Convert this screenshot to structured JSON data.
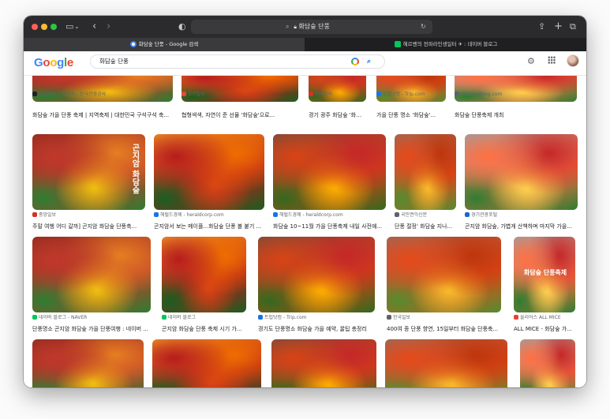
{
  "browser": {
    "url": "화담숲 단풍",
    "tabs": [
      {
        "title": "화담숲 단풍 - Google 검색",
        "active": true
      },
      {
        "title": "헤르벤의 전파라인생일터 ✈ : 네이버 블로그",
        "active": false
      }
    ]
  },
  "google": {
    "logo": "Google",
    "query": "화담숲 단풍",
    "logo_colors": [
      "#4285f4",
      "#ea4335",
      "#fbbc05",
      "#4285f4",
      "#34a853",
      "#ea4335"
    ]
  },
  "results": [
    {
      "source": "대한민국 구석구석 - 한국관광공사",
      "caption": "화담숲 가을 단풍 축제 | 지역축제 | 대한민국 구석구석 축...",
      "color": "#202124"
    },
    {
      "source": "조선일보",
      "caption": "협형색색, 자연이 준 선물 '화담숲'으로...",
      "color": "#e24a3b"
    },
    {
      "source": "이데일리",
      "caption": "경기 광주 화담숲 '화담...",
      "color": "#d93025"
    },
    {
      "source": "트립닷컴 - Trip.com",
      "caption": "가을 단풍 명소 '화담숲'...",
      "color": "#1a73e8"
    },
    {
      "source": "dnocorpblog.com",
      "caption": "화담숲 단풍축제 개최",
      "color": "#5f6368"
    },
    {
      "source": "중앙일보",
      "caption": "주말 여행 어디 갈까] 곤지암 화담숲 단풍축...",
      "color": "#d93025",
      "overlay": "곤지암 화담숲"
    },
    {
      "source": "헤럴드경제 - heraldcorp.com",
      "caption": "곤지암서 보는 메이플...화담숲 단풍 볼 붙기 ...",
      "color": "#1a73e8"
    },
    {
      "source": "헤럴드경제 - heraldcorp.com",
      "caption": "화담숲 10~11월 가을 단풍축제 내일 사전예...",
      "color": "#1a73e8"
    },
    {
      "source": "국민권익신문",
      "caption": "단풍 절정' 화담숲 지나...",
      "color": "#5f6368"
    },
    {
      "source": "경기관광포털",
      "caption": "곤지암 화담숲, 가볍게 산책하며 마지막 가을...",
      "color": "#1967d2"
    },
    {
      "source": "네이버 블로그 - NAVER",
      "caption": "단풍명소 곤지암 화담숲 가을 단풍여행 : 네이버 ...",
      "color": "#03c75a"
    },
    {
      "source": "네이버 블로그",
      "caption": "곤지암 화담숲 단풍 축제 시기 가...",
      "color": "#03c75a"
    },
    {
      "source": "트립닷컴 - Trip.com",
      "caption": "경기도 단풍명소 화담숲 가을 예약, 꿀팁 총정리",
      "color": "#1a73e8"
    },
    {
      "source": "한국일보",
      "caption": "400여 종 단풍 향연, 15일부터 화담숲 단풍축...",
      "color": "#5f6368"
    },
    {
      "source": "올리어스 ALL MICE",
      "caption": "ALL MICE - 화담숲 가...",
      "color": "#ea4335",
      "overlay": "화담숲 단풍축제"
    },
    {
      "source": "",
      "caption": "",
      "color": "#5f6368"
    },
    {
      "source": "",
      "caption": "",
      "color": "#5f6368"
    },
    {
      "source": "",
      "caption": "",
      "color": "#5f6368"
    },
    {
      "source": "",
      "caption": "",
      "color": "#5f6368"
    },
    {
      "source": "",
      "caption": "",
      "color": "#5f6368"
    }
  ]
}
